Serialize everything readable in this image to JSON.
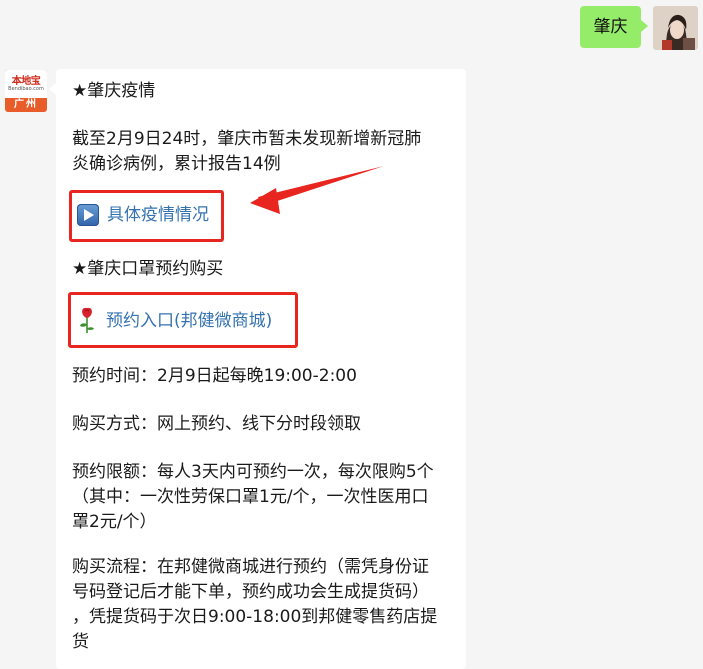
{
  "chat": {
    "outgoing": {
      "text": "肇庆"
    },
    "incoming": {
      "avatar": {
        "brand": "本地宝",
        "domain": "Bendibao.com",
        "city": "广州"
      },
      "lines": {
        "h1": "★肇庆疫情",
        "p1a": "截至2月9日24时，肇庆市暂未发现新增新冠肺",
        "p1b": "炎确诊病例，累计报告14例",
        "link1": "具体疫情情况",
        "h2": "★肇庆口罩预约购买",
        "link2": "预约入口(邦健微商城)",
        "time": "预约时间：2月9日起每晚19:00-2:00",
        "method": "购买方式：网上预约、线下分时段领取",
        "limit1": "预约限额：每人3天内可预约一次，每次限购5个",
        "limit2": "（其中：一次性劳保口罩1元/个，一次性医用口",
        "limit3": "罩2元/个）",
        "flow1": "购买流程：在邦健微商城进行预约（需凭身份证",
        "flow2": "号码登记后才能下单，预约成功会生成提货码）",
        "flow3": "，凭提货码于次日9:00-18:00到邦健零售药店提",
        "flow4": "货"
      }
    }
  },
  "icons": {
    "link1_icon": "play-button-icon",
    "link2_icon": "rose-icon"
  },
  "colors": {
    "outgoing_bubble": "#95ec69",
    "link": "#3572b0",
    "highlight": "#e8251e",
    "background": "#f5f5f5"
  }
}
